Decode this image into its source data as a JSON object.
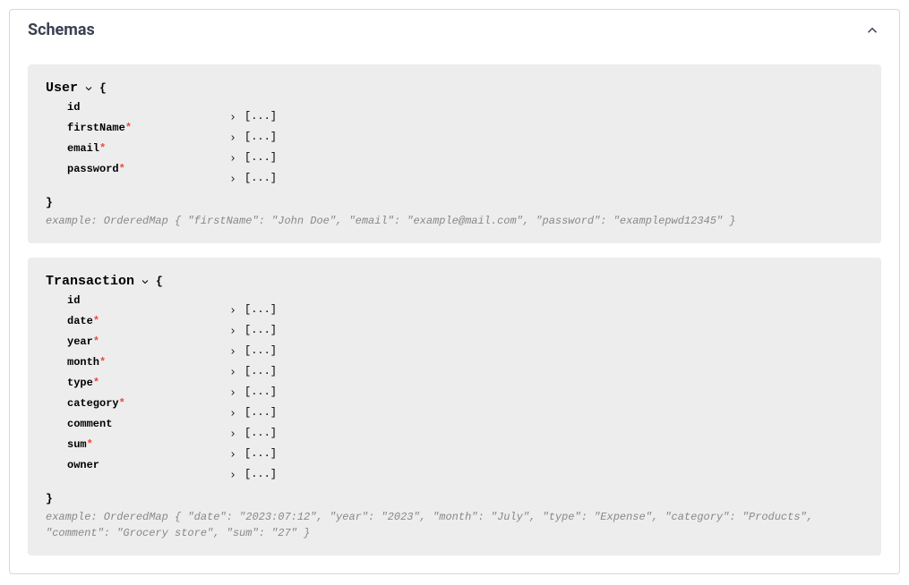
{
  "panel": {
    "title": "Schemas"
  },
  "schemas": [
    {
      "name": "User",
      "open_brace": "{",
      "close_brace": "}",
      "fields": [
        {
          "name": "id",
          "required": false
        },
        {
          "name": "firstName",
          "required": true
        },
        {
          "name": "email",
          "required": true
        },
        {
          "name": "password",
          "required": true
        }
      ],
      "ellipsis": "[...]",
      "example": "example: OrderedMap { \"firstName\": \"John Doe\", \"email\": \"example@mail.com\", \"password\": \"examplepwd12345\" }"
    },
    {
      "name": "Transaction",
      "open_brace": "{",
      "close_brace": "}",
      "fields": [
        {
          "name": "id",
          "required": false
        },
        {
          "name": "date",
          "required": true
        },
        {
          "name": "year",
          "required": true
        },
        {
          "name": "month",
          "required": true
        },
        {
          "name": "type",
          "required": true
        },
        {
          "name": "category",
          "required": true
        },
        {
          "name": "comment",
          "required": false
        },
        {
          "name": "sum",
          "required": true
        },
        {
          "name": "owner",
          "required": false
        }
      ],
      "ellipsis": "[...]",
      "example": "example: OrderedMap { \"date\": \"2023:07:12\", \"year\": \"2023\", \"month\": \"July\", \"type\": \"Expense\", \"category\": \"Products\", \"comment\": \"Grocery store\", \"sum\": \"27\" }"
    }
  ]
}
